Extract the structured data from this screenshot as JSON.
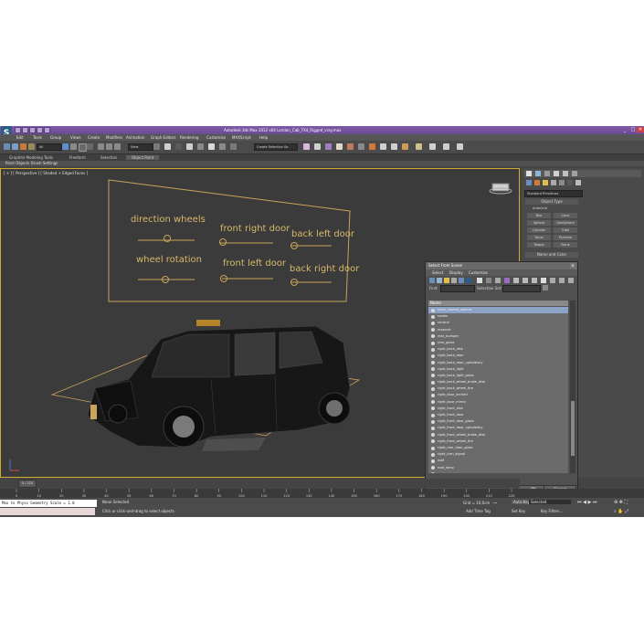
{
  "window": {
    "title": "Autodesk 3ds Max 2012 x64    London_Cab_TX4_Rigged_vray.max",
    "minimize": "_",
    "maximize": "□",
    "close": "✕"
  },
  "menu": [
    "Edit",
    "Tools",
    "Group",
    "Views",
    "Create",
    "Modifiers",
    "Animation",
    "Graph Editors",
    "Rendering",
    "Customize",
    "MAXScript",
    "Help"
  ],
  "toolbar": {
    "selection_filter": "All",
    "view_dropdown": "View",
    "named_set": "Create Selection Se"
  },
  "ribbon": {
    "tabs": [
      "Graphite Modeling Tools",
      "Freeform",
      "Selection",
      "Object Paint"
    ],
    "active_tab": "Object Paint",
    "row": [
      "Paint Objects",
      "Brush Settings"
    ]
  },
  "viewport": {
    "label": "[ + ] [ Perspective ] [ Shaded + Edged Faces ]",
    "rig_labels": [
      "direction wheels",
      "front right door",
      "back left door",
      "wheel rotation",
      "front left door",
      "back right door"
    ]
  },
  "command_panel": {
    "dropdown": "Standard Primitives",
    "rollout_title": "Object Type",
    "autogrid": "AutoGrid",
    "buttons": [
      "Box",
      "Cone",
      "Sphere",
      "GeoSphere",
      "Cylinder",
      "Tube",
      "Torus",
      "Pyramid",
      "Teapot",
      "Plane"
    ],
    "name_color": "Name and Color"
  },
  "dialog": {
    "title": "Select From Scene",
    "menu": [
      "Select",
      "Display",
      "Customize"
    ],
    "find_label": "Find:",
    "selection_set": "Selection Set:",
    "column_header": "Name",
    "items": [
      "main_control_splines",
      "nodes",
      "neutral",
      "rearpart",
      "rear_bumper",
      "rear_glass",
      "right_back_disk",
      "right_back_door",
      "right_back_door_upholstery",
      "right_back_light",
      "right_back_light_glass",
      "right_back_wheel_brake_disk",
      "right_back_wheel_tire",
      "right_door_arched",
      "right_door_mirror",
      "right_front_disk",
      "right_front_door",
      "right_front_door_glass",
      "right_front_door_upholstery",
      "right_front_wheel_brake_disk",
      "right_front_wheel_tire",
      "right_rear_door_glass",
      "right_turn_signal",
      "roof",
      "roof_lamp",
      "roof_upholstery",
      "roof_upholstery_handle"
    ],
    "ok": "OK",
    "cancel": "Cancel"
  },
  "timeline": {
    "frame": "0 / 225"
  },
  "ruler_ticks": [
    "0",
    "10",
    "20",
    "30",
    "40",
    "50",
    "60",
    "70",
    "80",
    "90",
    "100",
    "110",
    "120",
    "130",
    "140",
    "150",
    "160",
    "170",
    "180",
    "190",
    "200",
    "210",
    "220"
  ],
  "status": {
    "maxscript_line": "Max to Physx Geometry Scale = 1.0",
    "none_selected": "None Selected",
    "prompt": "Click or click-and-drag to select objects",
    "grid": "Grid = 10,0cm",
    "autokey": "Auto Key",
    "selected_dropdown": "Selected",
    "setkey": "Set Key",
    "key_filters": "Key Filters...",
    "add_time_tag": "Add Time Tag"
  },
  "colors": {
    "title_purple": "#6b4a93",
    "viewport_border": "#cfae2e",
    "rig_text": "#d9b86a"
  }
}
